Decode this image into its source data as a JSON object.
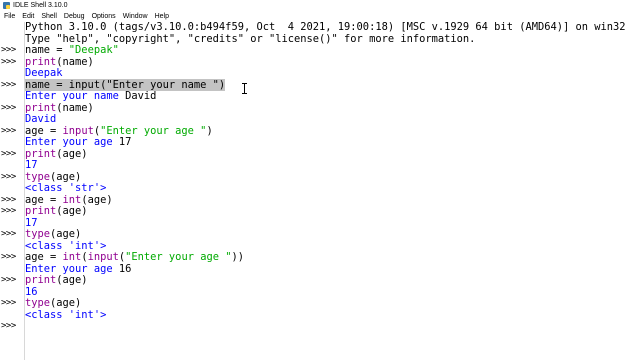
{
  "window": {
    "title": "IDLE Shell 3.10.0",
    "icon": "python-icon"
  },
  "menu": [
    "File",
    "Edit",
    "Shell",
    "Debug",
    "Options",
    "Window",
    "Help"
  ],
  "prompt": ">>>",
  "lines": [
    {
      "prompt": false,
      "segs": [
        {
          "t": "Python 3.10.0 (tags/v3.10.0:b494f59, Oct  4 2021, 19:00:18) [MSC v.1929 64 bit (AMD64)] on win32",
          "c": "plain"
        }
      ]
    },
    {
      "prompt": false,
      "segs": [
        {
          "t": "Type \"help\", \"copyright\", \"credits\" or \"license()\" for more information.",
          "c": "plain"
        }
      ]
    },
    {
      "prompt": true,
      "segs": [
        {
          "t": "name = ",
          "c": "in"
        },
        {
          "t": "\"Deepak\"",
          "c": "str"
        }
      ]
    },
    {
      "prompt": true,
      "segs": [
        {
          "t": "print",
          "c": "kw"
        },
        {
          "t": "(name)",
          "c": "in"
        }
      ]
    },
    {
      "prompt": false,
      "segs": [
        {
          "t": "Deepak",
          "c": "out"
        }
      ]
    },
    {
      "prompt": true,
      "selected": true,
      "segs": [
        {
          "t": "name = input(\"Enter your name \")",
          "c": "in"
        }
      ]
    },
    {
      "prompt": false,
      "segs": [
        {
          "t": "Enter your name ",
          "c": "out"
        },
        {
          "t": "David",
          "c": "in"
        }
      ]
    },
    {
      "prompt": true,
      "segs": [
        {
          "t": "print",
          "c": "kw"
        },
        {
          "t": "(name)",
          "c": "in"
        }
      ]
    },
    {
      "prompt": false,
      "segs": [
        {
          "t": "David",
          "c": "out"
        }
      ]
    },
    {
      "prompt": true,
      "segs": [
        {
          "t": "age = ",
          "c": "in"
        },
        {
          "t": "input",
          "c": "kw"
        },
        {
          "t": "(",
          "c": "in"
        },
        {
          "t": "\"Enter your age \"",
          "c": "str"
        },
        {
          "t": ")",
          "c": "in"
        }
      ]
    },
    {
      "prompt": false,
      "segs": [
        {
          "t": "Enter your age ",
          "c": "out"
        },
        {
          "t": "17",
          "c": "in"
        }
      ]
    },
    {
      "prompt": true,
      "segs": [
        {
          "t": "print",
          "c": "kw"
        },
        {
          "t": "(age)",
          "c": "in"
        }
      ]
    },
    {
      "prompt": false,
      "segs": [
        {
          "t": "17",
          "c": "out"
        }
      ]
    },
    {
      "prompt": true,
      "segs": [
        {
          "t": "type",
          "c": "kw"
        },
        {
          "t": "(age)",
          "c": "in"
        }
      ]
    },
    {
      "prompt": false,
      "segs": [
        {
          "t": "<class 'str'>",
          "c": "out"
        }
      ]
    },
    {
      "prompt": true,
      "segs": [
        {
          "t": "age = ",
          "c": "in"
        },
        {
          "t": "int",
          "c": "kw"
        },
        {
          "t": "(age)",
          "c": "in"
        }
      ]
    },
    {
      "prompt": true,
      "segs": [
        {
          "t": "print",
          "c": "kw"
        },
        {
          "t": "(age)",
          "c": "in"
        }
      ]
    },
    {
      "prompt": false,
      "segs": [
        {
          "t": "17",
          "c": "out"
        }
      ]
    },
    {
      "prompt": true,
      "segs": [
        {
          "t": "type",
          "c": "kw"
        },
        {
          "t": "(age)",
          "c": "in"
        }
      ]
    },
    {
      "prompt": false,
      "segs": [
        {
          "t": "<class 'int'>",
          "c": "out"
        }
      ]
    },
    {
      "prompt": true,
      "segs": [
        {
          "t": "age = ",
          "c": "in"
        },
        {
          "t": "int",
          "c": "kw"
        },
        {
          "t": "(",
          "c": "in"
        },
        {
          "t": "input",
          "c": "kw"
        },
        {
          "t": "(",
          "c": "in"
        },
        {
          "t": "\"Enter your age \"",
          "c": "str"
        },
        {
          "t": "))",
          "c": "in"
        }
      ]
    },
    {
      "prompt": false,
      "segs": [
        {
          "t": "Enter your age ",
          "c": "out"
        },
        {
          "t": "16",
          "c": "in"
        }
      ]
    },
    {
      "prompt": true,
      "segs": [
        {
          "t": "print",
          "c": "kw"
        },
        {
          "t": "(age)",
          "c": "in"
        }
      ]
    },
    {
      "prompt": false,
      "segs": [
        {
          "t": "16",
          "c": "out"
        }
      ]
    },
    {
      "prompt": true,
      "segs": [
        {
          "t": "type",
          "c": "kw"
        },
        {
          "t": "(age)",
          "c": "in"
        }
      ]
    },
    {
      "prompt": false,
      "segs": [
        {
          "t": "<class 'int'>",
          "c": "out"
        }
      ]
    },
    {
      "prompt": true,
      "segs": []
    }
  ],
  "colors": {
    "output": "#0000ff",
    "input": "#000000",
    "keyword": "#900090",
    "string": "#00aa00",
    "selection": "#c3c3c3"
  }
}
